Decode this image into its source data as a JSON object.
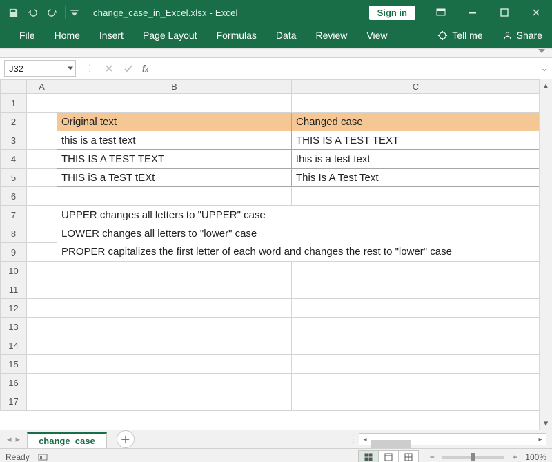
{
  "title": "change_case_in_Excel.xlsx - Excel",
  "signin": "Sign in",
  "ribbon_tabs": [
    "File",
    "Home",
    "Insert",
    "Page Layout",
    "Formulas",
    "Data",
    "Review",
    "View"
  ],
  "tellme": "Tell me",
  "share": "Share",
  "namebox": "J32",
  "formula_bar": "",
  "columns": [
    "A",
    "B",
    "C"
  ],
  "row_headers": [
    "1",
    "2",
    "3",
    "4",
    "5",
    "6",
    "7",
    "8",
    "9",
    "10",
    "11",
    "12",
    "13",
    "14",
    "15",
    "16",
    "17"
  ],
  "table": {
    "headers": {
      "b": "Original text",
      "c": "Changed case"
    },
    "rows": [
      {
        "b": "this is a test text",
        "c": "THIS IS A TEST TEXT"
      },
      {
        "b": "THIS IS A TEST TEXT",
        "c": "this is a test text"
      },
      {
        "b": "THIS iS a TeST tEXt",
        "c": "This Is A Test Text"
      }
    ]
  },
  "notes": {
    "r7": "UPPER changes all letters to \"UPPER\" case",
    "r8": "LOWER changes all letters to \"lower\" case",
    "r9": "PROPER capitalizes the first letter of each word and changes the rest to  \"lower\" case"
  },
  "sheet_tab": "change_case",
  "status_ready": "Ready",
  "zoom": "100%"
}
